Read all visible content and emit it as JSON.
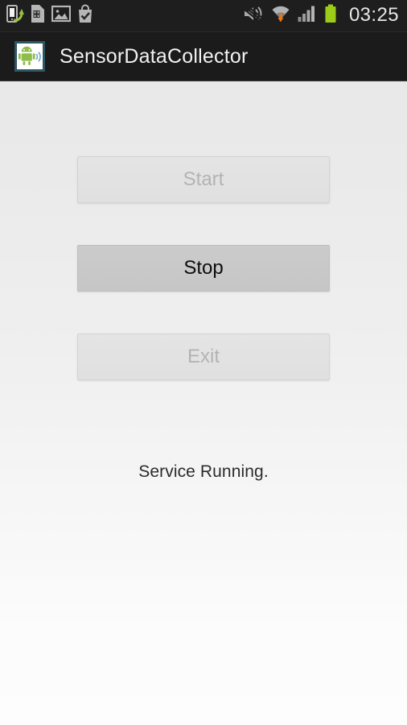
{
  "status_bar": {
    "icons_left": [
      {
        "name": "usb-transfer-icon",
        "label": "USB transfer"
      },
      {
        "name": "sim-card-alert-icon",
        "label": "SIM card alert"
      },
      {
        "name": "gallery-image-icon",
        "label": "Screenshot captured"
      },
      {
        "name": "play-store-update-icon",
        "label": "Play Store update"
      }
    ],
    "icons_right": [
      {
        "name": "volume-muted-icon",
        "label": "Sound muted"
      },
      {
        "name": "wifi-download-icon",
        "label": "Wi-Fi connected"
      },
      {
        "name": "signal-bars-icon",
        "label": "Cellular signal"
      },
      {
        "name": "battery-full-icon",
        "label": "Battery full"
      }
    ],
    "clock": "03:25",
    "background_color": "#1e1e1e",
    "battery_color": "#99cc00"
  },
  "action_bar": {
    "title": "SensorDataCollector",
    "icon": "app-launcher-icon",
    "background_color": "#1b1b1b",
    "icon_border_color": "#2e5763",
    "android_green": "#8fbc4b"
  },
  "main": {
    "buttons": [
      {
        "id": "start",
        "label": "Start",
        "enabled": false
      },
      {
        "id": "stop",
        "label": "Stop",
        "enabled": true
      },
      {
        "id": "exit",
        "label": "Exit",
        "enabled": false
      }
    ],
    "status_message": "Service Running.",
    "background_top_color": "#e9e9e9",
    "background_bottom_color": "#fdfdfd"
  }
}
